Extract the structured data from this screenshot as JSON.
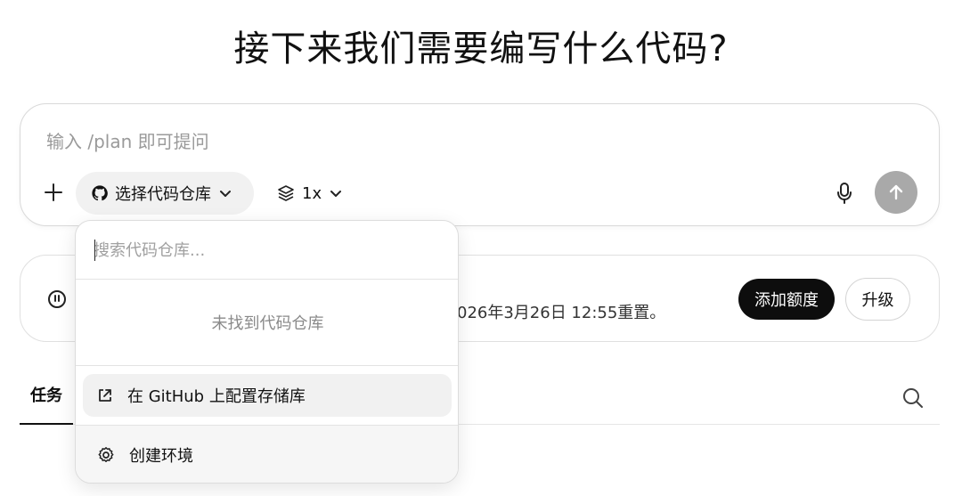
{
  "page": {
    "title": "接下来我们需要编写什么代码?"
  },
  "composer": {
    "placeholder": "输入 /plan 即可提问",
    "repo_button_label": "选择代码仓库",
    "count_label": "1x"
  },
  "quota": {
    "text": "026年3月26日 12:55重置。",
    "add_button": "添加额度",
    "upgrade_button": "升级"
  },
  "tabs": {
    "tasks": "任务"
  },
  "repo_dropdown": {
    "search_placeholder": "搜索代码仓库...",
    "empty_text": "未找到代码仓库",
    "configure_label": "在 GitHub 上配置存储库",
    "create_env_label": "创建环境"
  },
  "icons": {
    "plus": "plus-icon",
    "github": "github-icon",
    "chevron": "chevron-down-icon",
    "layers": "layers-icon",
    "mic": "microphone-icon",
    "send": "arrow-up-icon",
    "quota": "usage-meter-icon",
    "search": "search-icon",
    "external": "external-link-icon",
    "settings": "gear-icon"
  },
  "colors": {
    "send_button": "#a9a9a9",
    "add_quota_button": "#0d0d0d"
  }
}
